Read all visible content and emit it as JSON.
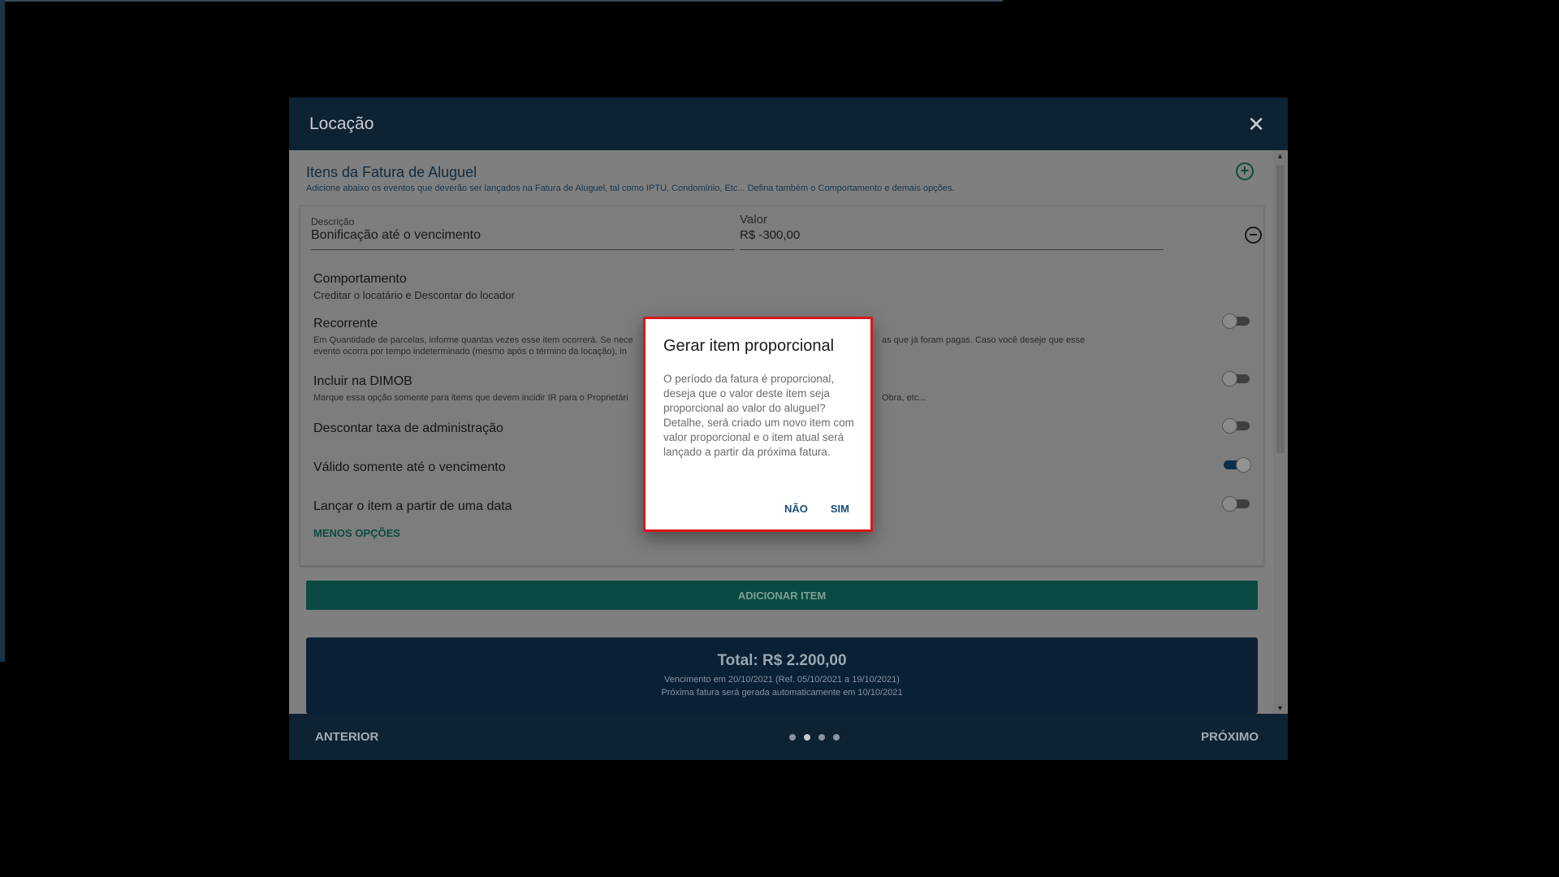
{
  "modal": {
    "title": "Locação",
    "close_symbol": "✕"
  },
  "section": {
    "title": "Itens da Fatura de Aluguel",
    "subtitle": "Adicione abaixo os eventos que deverão ser lançados na Fatura de Aluguel, tal como IPTU, Condomínio, Etc... Defina também o Comportamento e demais opções."
  },
  "item": {
    "descricao_label": "Descrição",
    "descricao_value": "Bonificação até o vencimento",
    "valor_label": "Valor",
    "valor_value": "R$ -300,00",
    "comportamento_title": "Comportamento",
    "comportamento_value": "Creditar o locatário e Descontar do locador",
    "recorrente_title": "Recorrente",
    "recorrente_desc_left_1": "Em Quantidade de parcelas, informe quantas vezes esse item ocorrerá. Se nece",
    "recorrente_desc_right_1": "as que já foram pagas. Caso você deseje que esse",
    "recorrente_desc_left_2": "evento ocorra por tempo indeterminado (mesmo após o término da locação), in",
    "dimob_title": "Incluir na DIMOB",
    "dimob_desc_left": "Marque essa opção somente para items que devem incidir IR para o Proprietári",
    "dimob_desc_right": "Obra, etc...",
    "taxa_title": "Descontar taxa de administração",
    "valido_title": "Válido somente até o vencimento",
    "lancar_title": "Lançar o item a partir de uma data",
    "less_options": "MENOS OPÇÕES"
  },
  "toggles": {
    "recorrente": false,
    "dimob": false,
    "taxa": false,
    "valido": true,
    "lancar": false
  },
  "add_item_label": "ADICIONAR ITEM",
  "total": {
    "title": "Total: R$ 2.200,00",
    "line1": "Vencimento em 20/10/2021 (Ref. 05/10/2021 a 19/10/2021)",
    "line2": "Próxima fatura será gerada automaticamente em 10/10/2021"
  },
  "footer": {
    "prev": "ANTERIOR",
    "next": "PRÓXIMO",
    "steps": 4,
    "active_step": 2
  },
  "dialog": {
    "title": "Gerar item proporcional",
    "text": "O período da fatura é proporcional, deseja que o valor deste item seja proporcional ao valor do aluguel? Detalhe, será criado um novo item com valor proporcional e o item atual será lançado a partir da próxima fatura.",
    "no": "NÃO",
    "yes": "SIM"
  },
  "icons": {
    "add": "add-circle-icon",
    "remove": "remove-circle-icon",
    "close": "close-icon"
  }
}
